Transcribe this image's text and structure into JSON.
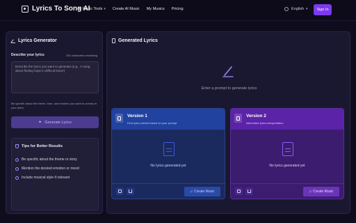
{
  "header": {
    "brand": "Lyrics To Song AI",
    "nav": [
      {
        "label": "AI Music Tools",
        "has_caret": true
      },
      {
        "label": "Create AI Music",
        "has_caret": false
      },
      {
        "label": "My Musics",
        "has_caret": false
      },
      {
        "label": "Pricing",
        "has_caret": false
      }
    ],
    "language": "English",
    "signin": "Sign In"
  },
  "left": {
    "title": "Lyrics Generator",
    "describe_label": "Describe your lyrics",
    "chars_remaining": "200 characters remaining",
    "textarea_placeholder": "Describe the lyrics you want to generate (e.g., 'A song about finding hope in difficult times')",
    "helper": "Be specific about the theme, tone, and emotion you want to convey in your lyrics.",
    "generate_button": "Generate Lyrics",
    "tips_title": "Tips for Better Results",
    "tips": [
      "Be specific about the theme or story",
      "Mention the desired emotion or mood",
      "Include musical style if relevant"
    ]
  },
  "right": {
    "title": "Generated Lyrics",
    "empty_prompt": "Enter a prompt to generate lyrics",
    "versions": [
      {
        "title": "Version 1",
        "subtitle": "First lyrics variant based on your prompt",
        "empty": "No lyrics generated yet",
        "create_button": "Create Music"
      },
      {
        "title": "Version 2",
        "subtitle": "Alternative lyrics interpretation",
        "empty": "No lyrics generated yet",
        "create_button": "Create Music"
      }
    ]
  },
  "colors": {
    "accent": "#7c3aed",
    "version1": "#2242a0",
    "version2": "#5a23a8",
    "background": "#0f0c1d"
  },
  "icons": [
    "logo-icon",
    "globe-icon",
    "pen-icon",
    "sparkle-icon",
    "shield-icon",
    "check-icon",
    "document-icon",
    "copy-icon",
    "download-icon",
    "music-note-icon"
  ]
}
